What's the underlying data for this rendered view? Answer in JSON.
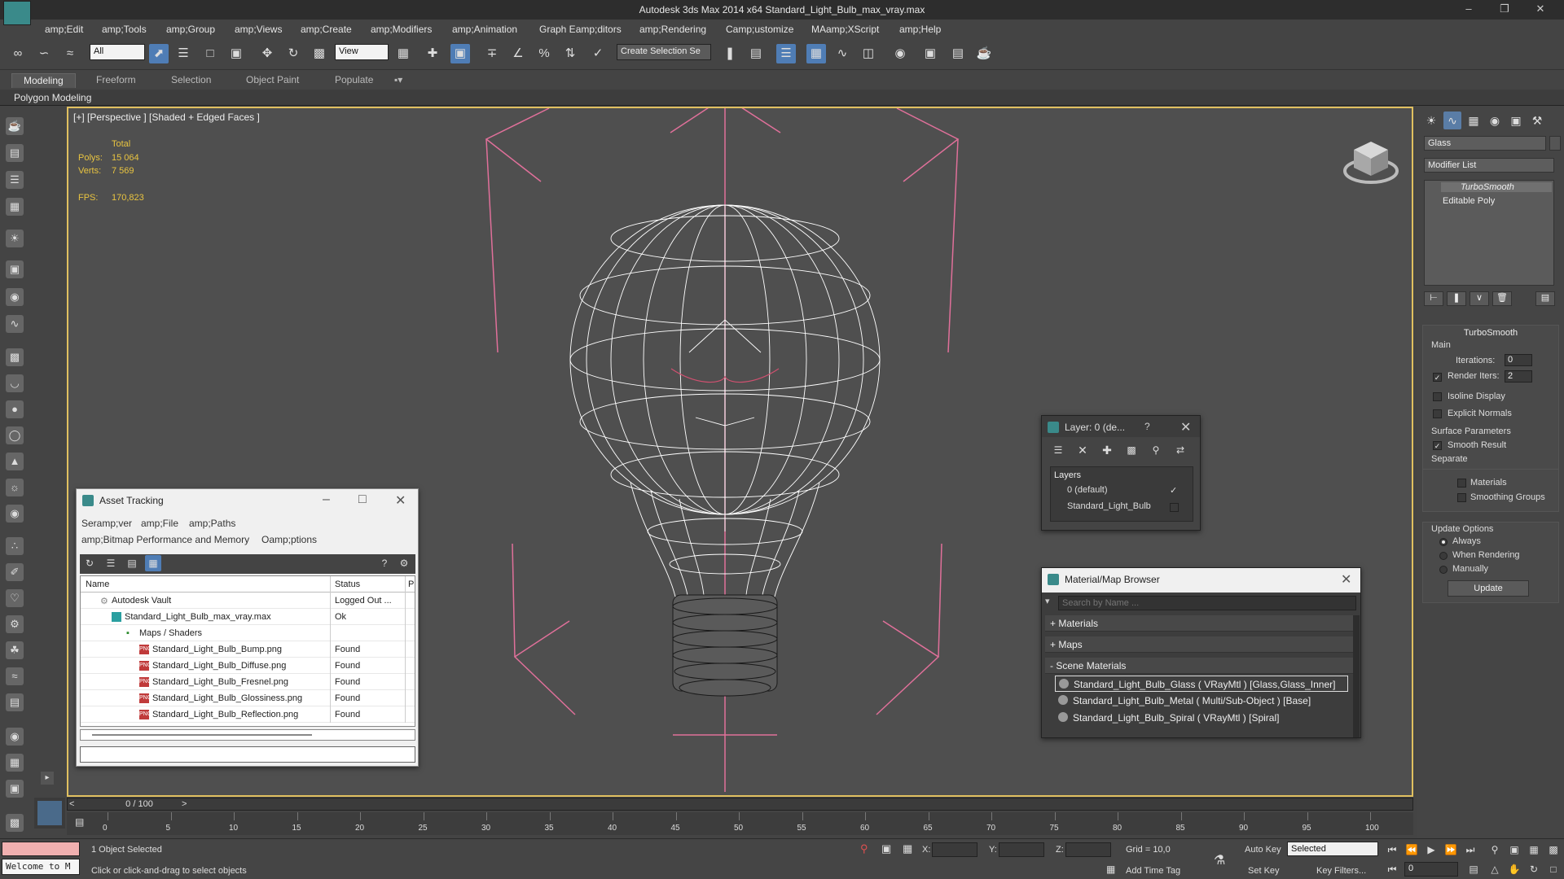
{
  "titlebar": {
    "title": "Autodesk 3ds Max  2014 x64     Standard_Light_Bulb_max_vray.max"
  },
  "menubar": [
    "amp;Edit",
    "amp;Tools",
    "amp;Group",
    "amp;Views",
    "amp;Create",
    "amp;Modifiers",
    "amp;Animation",
    "Graph Eamp;ditors",
    "amp;Rendering",
    "Camp;ustomize",
    "MAamp;XScript",
    "amp;Help"
  ],
  "toolbar": {
    "filter_value": "All",
    "coord_value": "View",
    "selection_set": "Create Selection Se"
  },
  "ribbon": {
    "tabs": [
      "Modeling",
      "Freeform",
      "Selection",
      "Object Paint",
      "Populate"
    ],
    "sub": "Polygon Modeling"
  },
  "viewport": {
    "label": "[+] [Perspective ] [Shaded + Edged Faces ]",
    "stats_header": "Total",
    "polys_label": "Polys:",
    "polys_value": "15 064",
    "verts_label": "Verts:",
    "verts_value": "7 569",
    "fps_label": "FPS:",
    "fps_value": "170,823"
  },
  "command_panel": {
    "object_name": "Glass",
    "modifier_list": "Modifier List",
    "stack": [
      "TurboSmooth",
      "Editable Poly"
    ],
    "rollout_title": "TurboSmooth",
    "main_label": "Main",
    "iterations_label": "Iterations:",
    "iterations_value": "0",
    "render_iters_label": "Render Iters:",
    "render_iters_value": "2",
    "isoline": "Isoline Display",
    "explicit_normals": "Explicit Normals",
    "surface_params": "Surface Parameters",
    "smooth_result": "Smooth Result",
    "separate": "Separate",
    "materials": "Materials",
    "smoothing_groups": "Smoothing Groups",
    "update_options": "Update Options",
    "always": "Always",
    "when_rendering": "When Rendering",
    "manually": "Manually",
    "update_btn": "Update"
  },
  "asset_tracking": {
    "title": "Asset Tracking",
    "menu": [
      "Seramp;ver",
      "amp;File",
      "amp;Paths"
    ],
    "menu2": [
      "amp;Bitmap Performance and Memory",
      "Oamp;ptions"
    ],
    "col_name": "Name",
    "col_status": "Status",
    "col_p": "Pr",
    "rows": [
      {
        "name": "Autodesk Vault",
        "status": "Logged Out ..."
      },
      {
        "name": "Standard_Light_Bulb_max_vray.max",
        "status": "Ok"
      },
      {
        "name": "Maps / Shaders",
        "status": ""
      },
      {
        "name": "Standard_Light_Bulb_Bump.png",
        "status": "Found"
      },
      {
        "name": "Standard_Light_Bulb_Diffuse.png",
        "status": "Found"
      },
      {
        "name": "Standard_Light_Bulb_Fresnel.png",
        "status": "Found"
      },
      {
        "name": "Standard_Light_Bulb_Glossiness.png",
        "status": "Found"
      },
      {
        "name": "Standard_Light_Bulb_Reflection.png",
        "status": "Found"
      }
    ],
    "png_label": "PNG"
  },
  "layer_dialog": {
    "title": "Layer: 0 (de...",
    "help": "?",
    "header": "Layers",
    "items": [
      "0 (default)",
      "Standard_Light_Bulb"
    ]
  },
  "material_browser": {
    "title": "Material/Map Browser",
    "search_placeholder": "Search by Name ...",
    "groups": [
      "+ Materials",
      "+ Maps",
      "- Scene Materials"
    ],
    "items": [
      "Standard_Light_Bulb_Glass ( VRayMtl ) [Glass,Glass_Inner]",
      "Standard_Light_Bulb_Metal ( Multi/Sub-Object ) [Base]",
      "Standard_Light_Bulb_Spiral ( VRayMtl ) [Spiral]"
    ]
  },
  "timeline": {
    "frame": "0 / 100",
    "ticks": [
      "0",
      "5",
      "10",
      "15",
      "20",
      "25",
      "30",
      "35",
      "40",
      "45",
      "50",
      "55",
      "60",
      "65",
      "70",
      "75",
      "80",
      "85",
      "90",
      "95",
      "100"
    ]
  },
  "status": {
    "welcome": "Welcome to M",
    "selected": "1 Object Selected",
    "hint": "Click or click-and-drag to select objects",
    "x_label": "X:",
    "y_label": "Y:",
    "z_label": "Z:",
    "grid": "Grid = 10,0",
    "add_time_tag": "Add Time Tag",
    "auto_key": "Auto Key",
    "set_key": "Set Key",
    "selected_dropdown": "Selected",
    "key_filters": "Key Filters...",
    "frame_field": "0"
  },
  "colors": {
    "accent": "#4f7db5",
    "viewport_border": "#e0c060",
    "stats": "#e9c440",
    "gizmo": "#e0709a"
  }
}
